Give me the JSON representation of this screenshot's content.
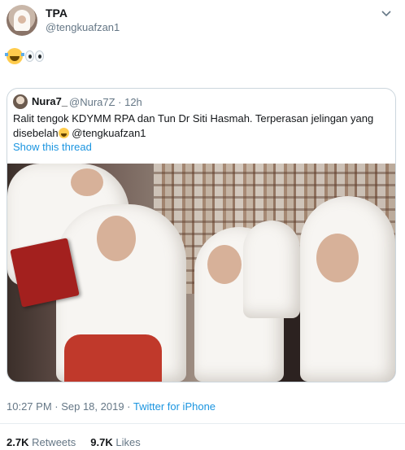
{
  "tweet": {
    "author": {
      "name": "TPA",
      "handle": "@tengkuafzan1"
    },
    "text_emojis": [
      "face-with-tears-of-joy",
      "eyes"
    ],
    "quoted": {
      "author": {
        "name": "Nura7_",
        "handle": "@Nura7Z · 12h"
      },
      "text_line1": "Ralit tengok KDYMM RPA dan Tun Dr Siti Hasmah. Terperasan jelingan yang",
      "text_line2_a": "disebelah",
      "text_line2_b": " @tengkuafzan1",
      "show_thread": "Show this thread"
    },
    "meta": {
      "time": "10:27 PM · Sep 18, 2019 · ",
      "source": "Twitter for iPhone"
    },
    "stats": {
      "retweets_count": "2.7K",
      "retweets_label": " Retweets",
      "likes_count": "9.7K",
      "likes_label": " Likes"
    }
  },
  "colors": {
    "link": "#1b95e0",
    "secondary": "#657786",
    "border": "#ccd6dd"
  }
}
